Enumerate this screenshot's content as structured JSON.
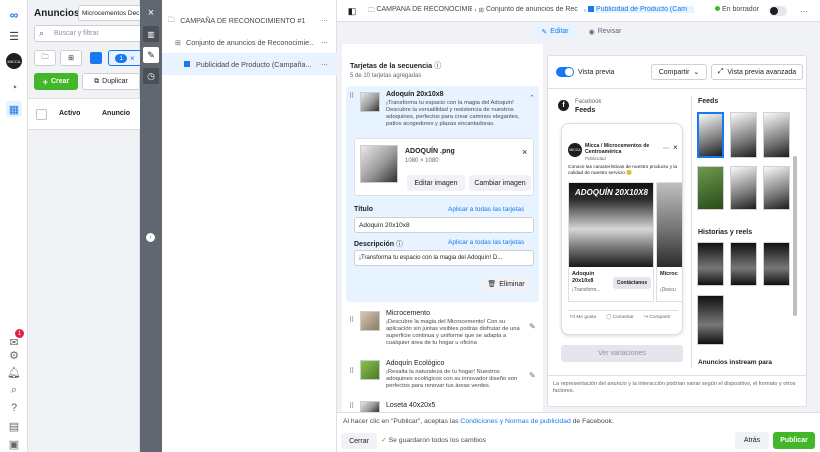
{
  "rail": {
    "badge_count": "1"
  },
  "left_panel": {
    "title": "Anuncios",
    "account_select": "Microcementos Dec",
    "search_placeholder": "Buscar y filtrar",
    "draft_count": "1",
    "create_label": "Crear",
    "duplicate_label": "Duplicar",
    "col_active": "Activo",
    "col_ad": "Anuncio"
  },
  "tree": {
    "campaign": "CAMPAÑA DE RECONOCIMIENTO #1",
    "adset": "Conjunto de anuncios de Reconocimie...",
    "ad": "Publicidad de Producto (Campaña..."
  },
  "topbar": {
    "crumb_campaign": "CAMPAÑA DE RECONOCIMIE",
    "crumb_adset": "Conjunto de anuncios de Rec",
    "crumb_ad": "Publicidad de Producto (Cam",
    "status": "En borrador",
    "edit": "Editar",
    "review": "Revisar"
  },
  "editor": {
    "section_title": "Tarjetas de la secuencia",
    "section_count": "5 de 10 tarjetas agregadas",
    "card1": {
      "title": "Adoquín 20x10x8",
      "desc": "¡Transforma tu espacio con la magia del Adoquín! Descubre la versatilidad y resistencia de nuestros adoquines, perfectos para crear caminos elegantes, patios acogedores y plazas encantadoras.",
      "file_name": "ADOQUÍN .png",
      "file_dims": "1080 × 1080",
      "edit_image": "Editar imagen",
      "change_image": "Cambiar imagen",
      "title_label": "Título",
      "apply_all": "Aplicar a todas las tarjetas",
      "title_value": "Adoquín 20x10x8",
      "desc_label": "Descripción",
      "desc_value": "¡Transforma tu espacio con la magia del Adoquín! D...",
      "delete": "Eliminar"
    },
    "card2": {
      "title": "Microcemento",
      "desc": "¡Descubre la magia del Microcemento! Con su aplicación sin juntas visibles podrás disfrutar de una superficie continua y uniforme que se adapta a cualquier área de tu hogar u oficina"
    },
    "card3": {
      "title": "Adoquín Ecológico",
      "desc": "¡Resalta la naturaleza de tu hogar! Nuestros adoquines ecológicos con su innovador diseño son perfectos para renovar tus áreas verdes."
    },
    "card4": {
      "title": "Loseta 40x20x5"
    }
  },
  "preview": {
    "toggle_label": "Vista previa",
    "share": "Compartir",
    "advanced": "Vista previa avanzada",
    "platform": "Facebook",
    "placement": "Feeds",
    "page_name": "Micca / Microcementos de Centroamérica",
    "sponsored": "Publicidad",
    "ad_text": "Conoce las características de nuestro producto y la calidad de nuestro servicio 😊",
    "img_title": "ADOQUÍN 20X10X8",
    "c1_title": "Adoquín 20x10x8",
    "c1_desc": "¡Transform...",
    "contact": "Contáctanos",
    "c2_title": "Microc",
    "c2_desc": "¡Descu",
    "like": "Me gusta",
    "comment": "Comentar",
    "share_action": "Compartir",
    "variations": "Ver variaciones",
    "sec_feeds": "Feeds",
    "sec_stories": "Historias y reels",
    "sec_instream": "Anuncios instream para",
    "disclaimer": "La representación del anuncio y la interacción podrían variar según el dispositivo, el formato y otros factores."
  },
  "footer": {
    "terms_pre": "Al hacer clic en \"Publicar\", aceptas las ",
    "terms_link": "Condiciones y Normas de publicidad",
    "terms_post": " de Facebook.",
    "close": "Cerrar",
    "saved": "Se guardaron todos los cambios",
    "back": "Atrás",
    "publish": "Publicar"
  },
  "colors": {
    "brand": "#1877f2",
    "green": "#42b72a",
    "publish": "#42b72a"
  }
}
